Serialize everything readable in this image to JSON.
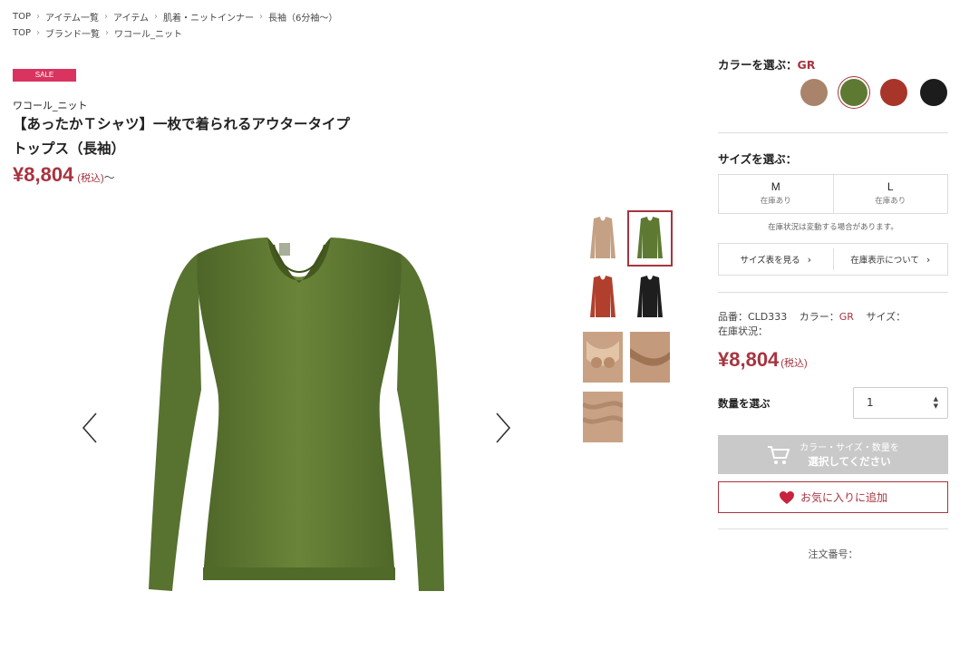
{
  "breadcrumbs": {
    "row1": [
      "TOP",
      "アイテム一覧",
      "アイテム",
      "肌着・ニットインナー",
      "長袖（6分袖〜）"
    ],
    "row2": [
      "TOP",
      "ブランド一覧",
      "ワコール_ニット"
    ]
  },
  "product": {
    "badge": "SALE",
    "brand": "ワコール_ニット",
    "title_line1": "【あったかＴシャツ】一枚で着られるアウタータイプ",
    "title_line2": "トップス（長袖）",
    "price": "¥8,804",
    "tax_label": "(税込)",
    "price_suffix": "〜"
  },
  "colors": {
    "label": "カラーを選ぶ：",
    "selected": "GR",
    "swatches": [
      {
        "name": "beige",
        "hex": "#a9846a"
      },
      {
        "name": "green",
        "hex": "#5e7a32"
      },
      {
        "name": "red",
        "hex": "#a8352a"
      },
      {
        "name": "black",
        "hex": "#1c1c1c"
      }
    ]
  },
  "sizes": {
    "label": "サイズを選ぶ：",
    "options": [
      {
        "name": "M",
        "stock": "在庫あり"
      },
      {
        "name": "L",
        "stock": "在庫あり"
      }
    ],
    "note": "在庫状況は変動する場合があります。",
    "size_chart_link": "サイズ表を見る",
    "stock_display_link": "在庫表示について"
  },
  "info": {
    "item_no_label": "品番：",
    "item_no": "CLD333",
    "color_label": "カラー：",
    "color_value": "GR",
    "size_label": "サイズ：",
    "stock_label": "在庫状況："
  },
  "price_right": {
    "price": "¥8,804",
    "tax_label": "(税込)"
  },
  "quantity": {
    "label": "数量を選ぶ",
    "value": "1"
  },
  "cart_button": {
    "line1": "カラー・サイズ・数量を",
    "line2": "選択してください"
  },
  "favorite_button": {
    "label": "お気に入りに追加"
  },
  "order_number": {
    "label": "注文番号："
  },
  "theme": {
    "accent": "#a7343f",
    "sale": "#d8345f",
    "garment": "#5e7a32"
  }
}
